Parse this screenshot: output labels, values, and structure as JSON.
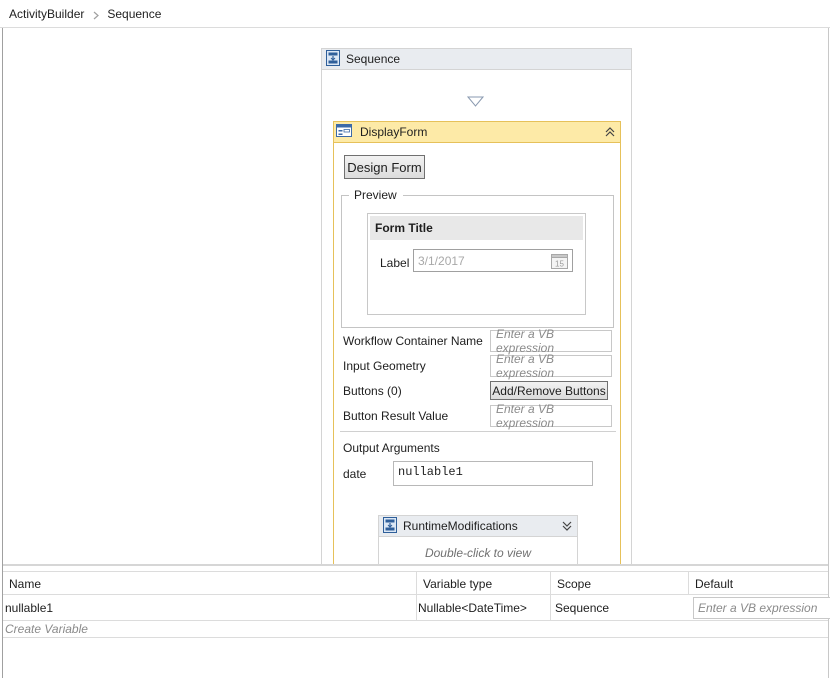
{
  "breadcrumb": {
    "items": [
      "ActivityBuilder",
      "Sequence"
    ]
  },
  "sequence": {
    "title": "Sequence"
  },
  "display_form": {
    "title": "DisplayForm",
    "design_button": "Design Form",
    "preview_legend": "Preview",
    "form_title": "Form Title",
    "field_label": "Label",
    "date_value": "3/1/2017",
    "calendar_day": "15",
    "properties": {
      "workflow_container_label": "Workflow Container Name",
      "workflow_container_placeholder": "Enter a VB expression",
      "input_geometry_label": "Input Geometry",
      "input_geometry_placeholder": "Enter a VB expression",
      "buttons_label": "Buttons (0)",
      "buttons_action": "Add/Remove Buttons",
      "button_result_label": "Button Result Value",
      "button_result_placeholder": "Enter a VB expression"
    },
    "output_arguments_title": "Output Arguments",
    "output_arg_name": "date",
    "output_arg_value": "nullable1"
  },
  "runtime_mod": {
    "title": "RuntimeModifications",
    "hint": "Double-click to view"
  },
  "variables": {
    "columns": [
      "Name",
      "Variable type",
      "Scope",
      "Default"
    ],
    "rows": [
      {
        "name": "nullable1",
        "type": "Nullable<DateTime>",
        "scope": "Sequence",
        "default_placeholder": "Enter a VB expression"
      }
    ],
    "create_label": "Create Variable"
  },
  "icons": {
    "sequence": "sequence-icon",
    "display_form": "form-icon",
    "runtime": "sequence-icon",
    "collapse": "double-chevron-up-icon",
    "expand": "double-chevron-down-icon",
    "calendar": "calendar-icon",
    "drop": "drop-target-arrow-icon",
    "breadcrumb_sep": "chevron-right-icon"
  },
  "colors": {
    "activity_header": "#fdeaa7",
    "activity_border": "#e6c15a",
    "sequence_header": "#e9ecf0"
  }
}
